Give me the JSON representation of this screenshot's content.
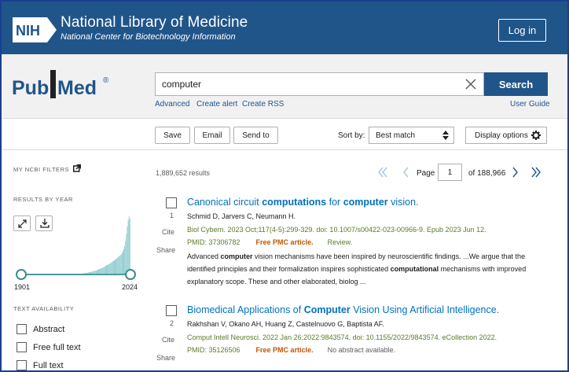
{
  "header": {
    "nih_badge": "NIH",
    "title": "National Library of Medicine",
    "subtitle": "National Center for Biotechnology Information",
    "login_label": "Log in"
  },
  "search": {
    "logo_text_left": "Pub",
    "logo_text_right": "Med",
    "logo_reg": "®",
    "query": "computer",
    "button_label": "Search",
    "links": {
      "advanced": "Advanced",
      "create_alert": "Create alert",
      "create_rss": "Create RSS",
      "user_guide": "User Guide"
    }
  },
  "toolbar": {
    "save": "Save",
    "email": "Email",
    "send_to": "Send to",
    "sort_by_label": "Sort by:",
    "sort_value": "Best match",
    "display_options": "Display options"
  },
  "sidebar": {
    "my_filters": "MY NCBI FILTERS",
    "results_by_year": "RESULTS BY YEAR",
    "year_start": "1901",
    "year_end": "2024",
    "text_availability": "TEXT AVAILABILITY",
    "filters": [
      "Abstract",
      "Free full text",
      "Full text"
    ]
  },
  "results": {
    "count": "1,889,652 results",
    "page_label": "Page",
    "page_current": "1",
    "page_total": "of 188,966",
    "items": [
      {
        "number": "1",
        "cite": "Cite",
        "share": "Share",
        "title_parts": [
          "Canonical circuit ",
          "computations",
          " for ",
          "computer",
          " vision."
        ],
        "authors": "Schmid D, Jarvers C, Neumann H.",
        "citation": "Biol Cybern. 2023 Oct;117(4-5):299-329. doi: 10.1007/s00422-023-00966-9. Epub 2023 Jun 12.",
        "pmid": "PMID: 37306782",
        "free": "Free PMC article.",
        "extra": "Review.",
        "snippet_parts": [
          "Advanced ",
          "computer",
          " vision mechanisms have been inspired by neuroscientific findings. ...We argue that the identified principles and their formalization inspires sophisticated ",
          "computational",
          " mechanisms with improved explanatory scope. These and other elaborated, biolog ..."
        ]
      },
      {
        "number": "2",
        "cite": "Cite",
        "share": "Share",
        "title_parts": [
          "Biomedical Applications of ",
          "Computer",
          " Vision Using Artificial Intelligence.",
          "",
          ""
        ],
        "authors": "Rakhshan V, Okano AH, Huang Z, Castelnuovo G, Baptista AF.",
        "citation": "Comput Intell Neurosci. 2022 Jan 26;2022:9843574. doi: 10.1155/2022/9843574. eCollection 2022.",
        "pmid": "PMID: 35126506",
        "free": "Free PMC article.",
        "extra": "No abstract available."
      }
    ]
  },
  "histogram": {
    "values": [
      0,
      0,
      0,
      0,
      0,
      0,
      0,
      0,
      0,
      0,
      0,
      0,
      0,
      0,
      0,
      0,
      0,
      0,
      0,
      0,
      0,
      0,
      0,
      0,
      0,
      0,
      0,
      0,
      0,
      0,
      0,
      0,
      0,
      0,
      0,
      0,
      0,
      0,
      0,
      0,
      0,
      0,
      0,
      0,
      0,
      0,
      0,
      0,
      0,
      0,
      0,
      0,
      0,
      0,
      0,
      0,
      0,
      0,
      0,
      0,
      0,
      0,
      0,
      0,
      0,
      0.5,
      0.5,
      0.5,
      1,
      1,
      1,
      1.5,
      1.5,
      2,
      2,
      2,
      2.5,
      2.5,
      3,
      3,
      3.5,
      3.5,
      4,
      4,
      4.5,
      5,
      5,
      5.5,
      6,
      6.5,
      7,
      7.5,
      8,
      8.5,
      9,
      9.5,
      10,
      11,
      12,
      12.5,
      13,
      13.5,
      14,
      15,
      16,
      17,
      17.5,
      18,
      19,
      20,
      21,
      22,
      23,
      24,
      25,
      26,
      28,
      30,
      33,
      37,
      43,
      52,
      62,
      70,
      75,
      72
    ]
  },
  "colors": {
    "nih_blue": "#20558a",
    "link_blue": "#0071bc",
    "free_orange": "#c05600",
    "histogram": "#7fc4c7"
  }
}
